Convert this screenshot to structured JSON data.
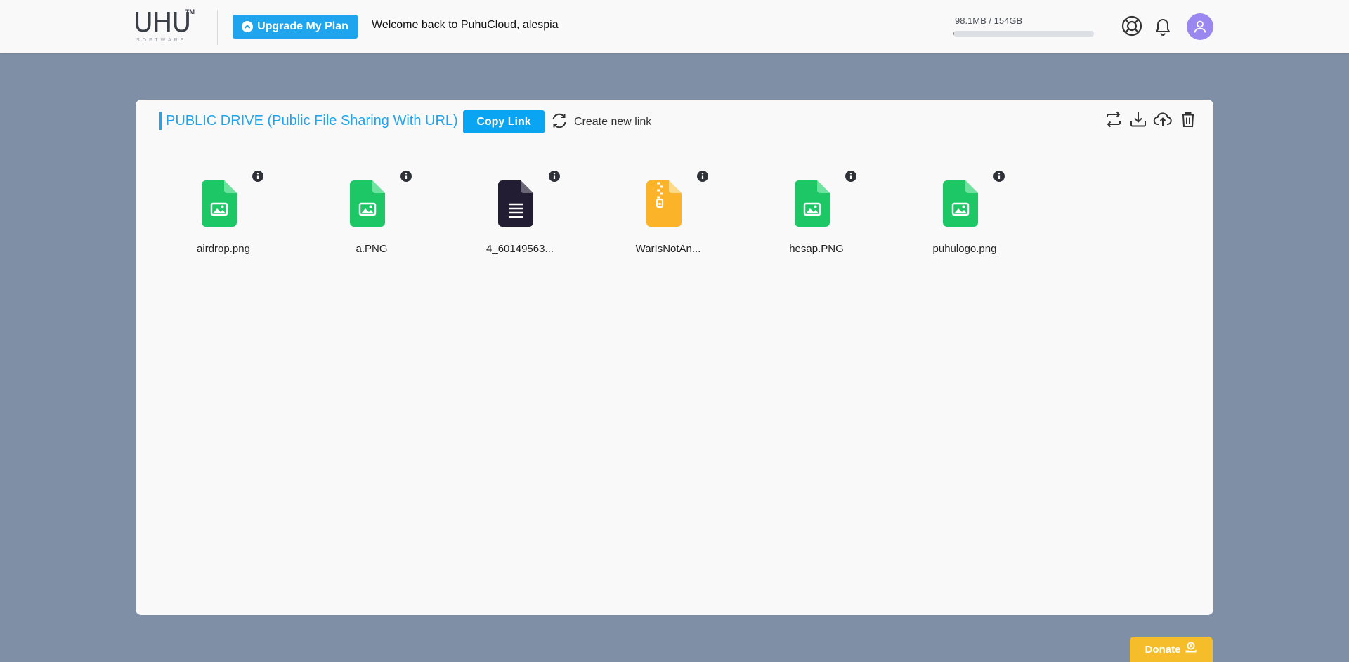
{
  "header": {
    "logo_text": "UHU",
    "logo_tm": "TM",
    "logo_sub": "SOFTWARE",
    "upgrade_label": "Upgrade My Plan",
    "welcome": "Welcome back to PuhuCloud, alespia",
    "storage_text": "98.1MB / 154GB",
    "storage_used_fraction": 0.004,
    "icons": [
      "support-lifebuoy-icon",
      "notification-bell-icon",
      "user-avatar-icon"
    ]
  },
  "panel": {
    "title": "PUBLIC DRIVE (Public File Sharing With URL)",
    "copy_link_label": "Copy Link",
    "create_new_link_label": "Create new link",
    "toolbar_icons": [
      "swap-icon",
      "download-icon",
      "upload-cloud-icon",
      "trash-icon"
    ]
  },
  "files": [
    {
      "name": "airdrop.png",
      "type": "image",
      "color": "#1ec766"
    },
    {
      "name": "a.PNG",
      "type": "image",
      "color": "#1ec766"
    },
    {
      "name": "4_60149563...",
      "type": "document",
      "color": "#231d33"
    },
    {
      "name": "WarIsNotAn...",
      "type": "archive",
      "color": "#fbb42a"
    },
    {
      "name": "hesap.PNG",
      "type": "image",
      "color": "#1ec766"
    },
    {
      "name": "puhulogo.png",
      "type": "image",
      "color": "#1ec766"
    }
  ],
  "donate_label": "Donate",
  "colors": {
    "accent": "#1ea5ee",
    "background": "#7f8fa6",
    "donate": "#f6bd2b",
    "avatar": "#9b87f0"
  }
}
